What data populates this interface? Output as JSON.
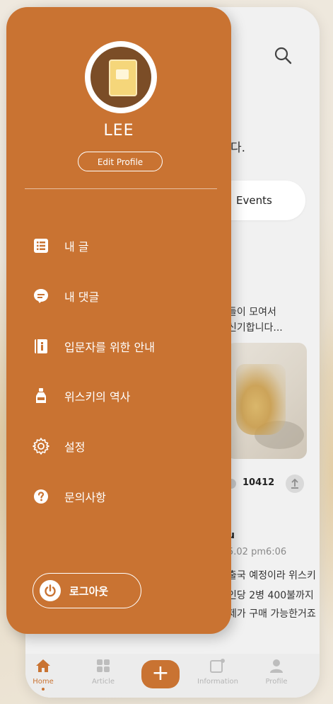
{
  "drawer": {
    "user_name": "LEE",
    "edit_profile_label": "Edit Profile",
    "menu": [
      {
        "label": "내 글",
        "icon": "list-icon"
      },
      {
        "label": "내 댓글",
        "icon": "comment-icon"
      },
      {
        "label": "입문자를 위한 안내",
        "icon": "info-book-icon"
      },
      {
        "label": "위스키의 역사",
        "icon": "bottle-icon"
      },
      {
        "label": "설정",
        "icon": "gear-icon"
      },
      {
        "label": "문의사항",
        "icon": "help-icon"
      }
    ],
    "logout_label": "로그아웃",
    "colors": {
      "drawer_bg": "#c97332",
      "text": "#ffffff"
    }
  },
  "main": {
    "greeting_tail": "다.",
    "events_tab": "Events",
    "post": {
      "text_line1": "들이 모여서",
      "text_line2": "신기합니다...",
      "view_count": "10412"
    },
    "post2": {
      "author_tail": "u",
      "time": "5.02 pm6:06",
      "line1": "출국 예정이라 위스키",
      "line2": "인당 2병 400불까지",
      "line3": "제가 구매 가능한거죠"
    }
  },
  "bottom_nav": {
    "items": [
      {
        "label": "Home",
        "icon": "home-icon",
        "active": true
      },
      {
        "label": "Article",
        "icon": "grid-icon",
        "active": false
      },
      {
        "label": "+",
        "icon": "plus-icon",
        "active": false
      },
      {
        "label": "Information",
        "icon": "note-icon",
        "active": false
      },
      {
        "label": "Profile",
        "icon": "person-icon",
        "active": false
      }
    ],
    "accent_color": "#c97332"
  }
}
